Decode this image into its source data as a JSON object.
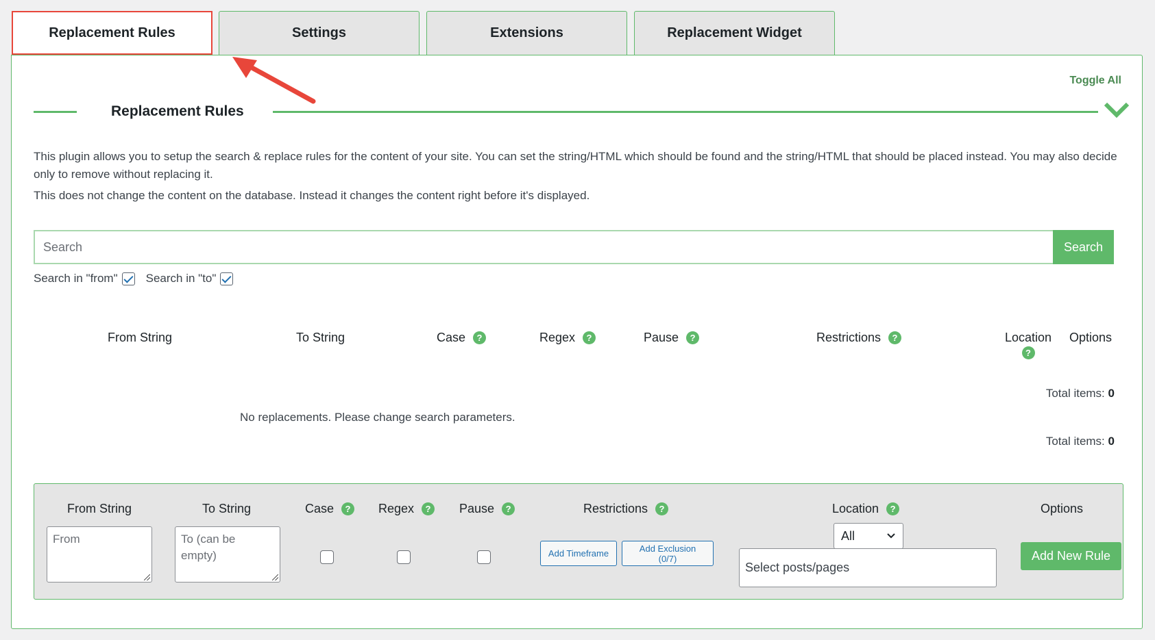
{
  "tabs": [
    {
      "label": "Replacement Rules",
      "active": true
    },
    {
      "label": "Settings",
      "active": false
    },
    {
      "label": "Extensions",
      "active": false
    },
    {
      "label": "Replacement Widget",
      "active": false
    }
  ],
  "section": {
    "title": "Replacement Rules",
    "toggle_all": "Toggle All"
  },
  "description": {
    "p1": "This plugin allows you to setup the search & replace rules for the content of your site. You can set the string/HTML which should be found and the string/HTML that should be placed instead. You may also decide only to remove without replacing it.",
    "p2": "This does not change the content on the database. Instead it changes the content right before it's displayed."
  },
  "search": {
    "placeholder": "Search",
    "button": "Search",
    "in_from": "Search in \"from\"",
    "in_to": "Search in \"to\"",
    "in_from_checked": true,
    "in_to_checked": true
  },
  "table": {
    "headers": {
      "from": "From String",
      "to": "To String",
      "case": "Case",
      "regex": "Regex",
      "pause": "Pause",
      "restrictions": "Restrictions",
      "location": "Location",
      "options": "Options"
    },
    "total_label": "Total items:",
    "total_value": "0",
    "empty_message": "No replacements. Please change search parameters."
  },
  "add_form": {
    "headers": {
      "from": "From String",
      "to": "To String",
      "case": "Case",
      "regex": "Regex",
      "pause": "Pause",
      "restrictions": "Restrictions",
      "location": "Location",
      "options": "Options"
    },
    "from_placeholder": "From",
    "to_placeholder": "To (can be empty)",
    "add_timeframe": "Add Timeframe",
    "add_exclusion": "Add Exclusion (0/7)",
    "location_value": "All",
    "posts_placeholder": "Select posts/pages",
    "add_button": "Add New Rule"
  },
  "help_icon": "?",
  "colors": {
    "accent_green": "#5fb96a",
    "highlight_red": "#e8463a",
    "link_blue": "#2271b1"
  }
}
